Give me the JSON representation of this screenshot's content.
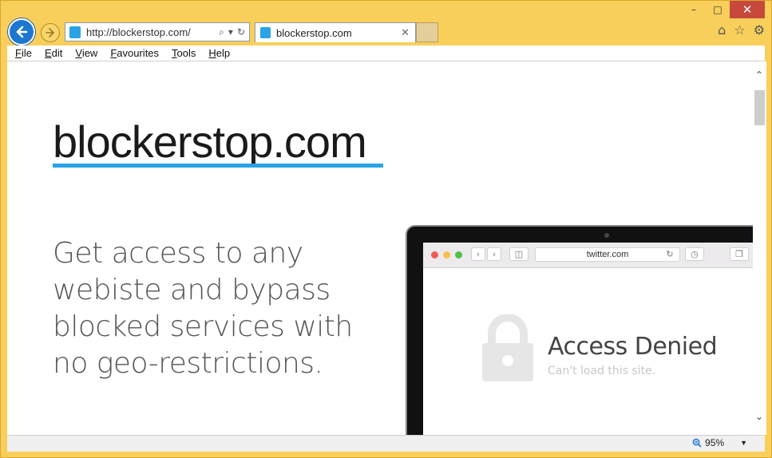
{
  "window": {
    "caption": {
      "minimize": "–",
      "maximize": "□",
      "close": "✕"
    }
  },
  "nav": {
    "back_icon": "back-arrow-icon",
    "forward_icon": "forward-arrow-icon",
    "address_url": "http://blockerstop.com/",
    "search_icon": "⌕",
    "dropdown_icon": "▾",
    "refresh_icon": "↻",
    "tab_label": "blockerstop.com",
    "tab_close": "✕",
    "home_icon": "⌂",
    "favorites_icon": "☆",
    "settings_icon": "⚙"
  },
  "menubar": {
    "items": [
      "File",
      "Edit",
      "View",
      "Favourites",
      "Tools",
      "Help"
    ]
  },
  "page": {
    "site_title": "blockerstop.com",
    "tagline": "Get access to any webiste and bypass blocked services with no geo-restrictions.",
    "accent_color": "#29a3e6",
    "laptop": {
      "url": "twitter.com",
      "access_title": "Access Denied",
      "access_subtitle": "Can't load this site."
    }
  },
  "statusbar": {
    "zoom": "95%"
  }
}
